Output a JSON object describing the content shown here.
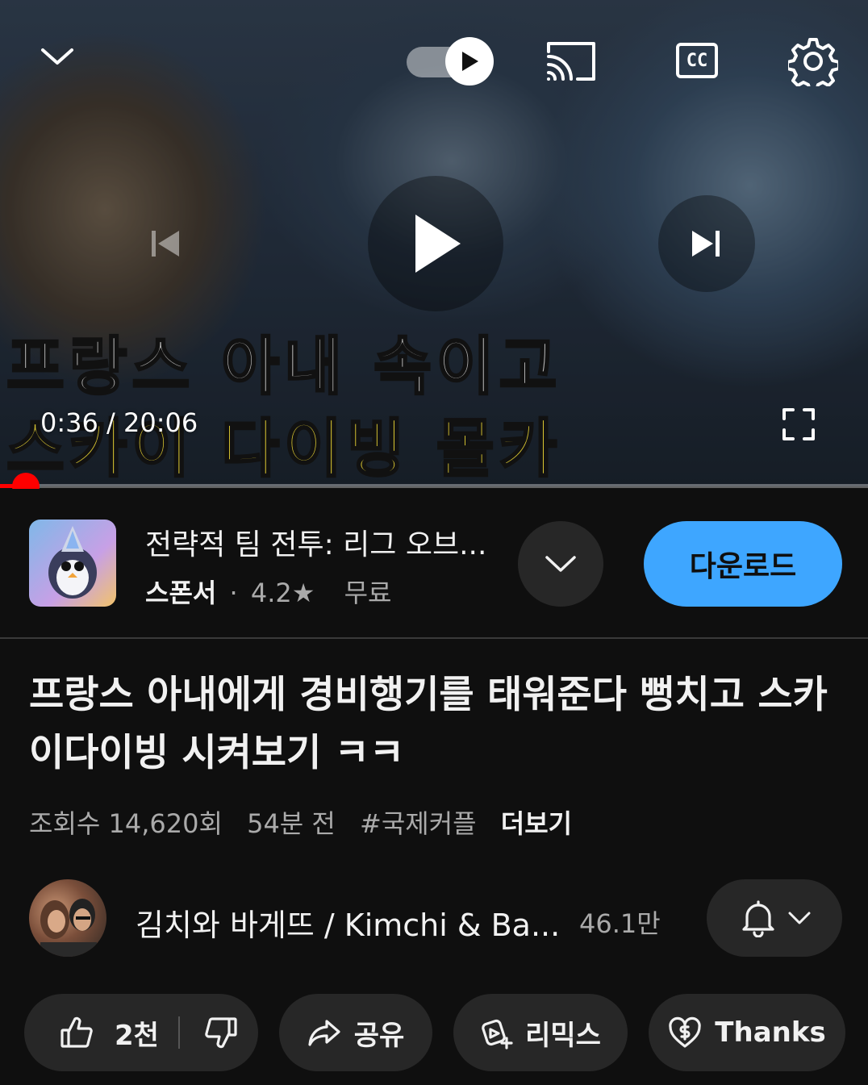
{
  "player": {
    "overlay_line1": "프랑스 아내 속이고",
    "overlay_line2": "스카이 다이빙 몰카",
    "current_time": "0:36",
    "duration": "20:06",
    "time_display": "0:36 / 20:06",
    "progress_fraction": 0.03,
    "autoplay_on": true,
    "icons": {
      "minimize": "chevron-down-icon",
      "autoplay": "autoplay-toggle-icon",
      "cast": "cast-icon",
      "captions": "cc-icon",
      "settings": "gear-icon",
      "previous": "skip-previous-icon",
      "play": "play-icon",
      "next": "skip-next-icon",
      "fullscreen": "fullscreen-icon"
    },
    "captions_label": "CC"
  },
  "ad": {
    "title": "전략적 팀 전투: 리그 오브...",
    "sponsor_label": "스폰서",
    "separator": "·",
    "rating": "4.2★",
    "price": "무료",
    "download_label": "다운로드"
  },
  "video": {
    "title": "프랑스 아내에게 경비행기를 태워준다 뻥치고 스카이다이빙 시켜보기 ㅋㅋ",
    "views": "조회수 14,620회",
    "age": "54분 전",
    "hashtag": "#국제커플",
    "more_label": "더보기"
  },
  "channel": {
    "name": "김치와 바게뜨 / Kimchi & Ba...",
    "subscribers": "46.1만"
  },
  "actions": {
    "like_count": "2천",
    "share_label": "공유",
    "remix_label": "리믹스",
    "thanks_label": "Thanks"
  },
  "colors": {
    "background": "#0f0f0f",
    "accent_red": "#ff0000",
    "download_blue": "#3ea6ff",
    "pill_gray": "#272727",
    "overlay_yellow": "#d8c531"
  }
}
